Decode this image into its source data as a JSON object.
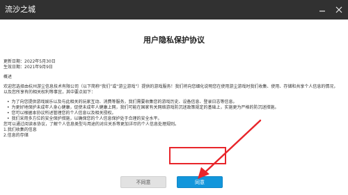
{
  "window": {
    "title": "流沙之城",
    "controls": [
      "minimize-icon",
      "close-icon"
    ]
  },
  "document": {
    "title": "用户隐私保护协议",
    "updated": "更新日期：2022年5月30日",
    "effective": "生效日期：2021年9月9日",
    "heading": "概述",
    "intro": "欢迎您选择由杭州游尘信息技术有限公司（以下简称“我们”或“游尘游戏”）提供的游戏服务！我们将向您细化说明您在使用游尘游戏时我们收集、使用、存储和共享个人信息的情况，以及您所享有的相关权利等事宜，其中要点如下：",
    "bullets": [
      "为了向您提供游戏娱乐以及与此相关的玩家互动、消费等服务，我们需要收集您的游戏历史、设备信息、登录日志等信息。",
      "为更好地保护未成年人身心健康，促使未成年人健康上网，我们可能在国家有关网络游戏防沉迷政策规定的基础上，实施更为严格的防沉迷措施。",
      "您可以根据本协议所述管理您的个人信息以及相关授权。",
      "我们采用多方位的安全保护措施，以确保您的个人信息保护处于合理的安全水平。"
    ],
    "outro": "您可以通过阅读本协议，了解个人信息类型与用途的对应关系等更加详尽的个人信息处理规则。",
    "section1": "1.我们收集的信息",
    "section2": "2.信息的存储"
  },
  "buttons": {
    "decline": "不同意",
    "agree": "同意"
  },
  "colors": {
    "titlebar": "#313131",
    "agree": "#1296db",
    "annotation": "#e8252a"
  }
}
